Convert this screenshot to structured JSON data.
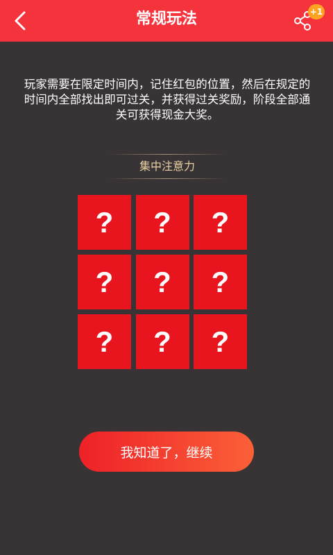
{
  "header": {
    "title": "常规玩法",
    "back_icon": "chevron-left-icon",
    "share_icon": "share-icon",
    "share_badge": "+1",
    "background": "#f4333c"
  },
  "intro": {
    "text": "玩家需要在限定时间内，记住红包的位置，然后在规定的时间内全部找出即可过关，并获得过关奖励，阶段全部通关可获得现金大奖。"
  },
  "section": {
    "label": "集中注意力"
  },
  "cards": [
    "?",
    "?",
    "?",
    "?",
    "?",
    "?",
    "?",
    "?",
    "?"
  ],
  "continue_button": {
    "label": "我知道了，继续"
  },
  "colors": {
    "page_background": "#383334",
    "card": "#e8141e",
    "badge": "#ffa323",
    "section_label": "#e8d2a4"
  }
}
